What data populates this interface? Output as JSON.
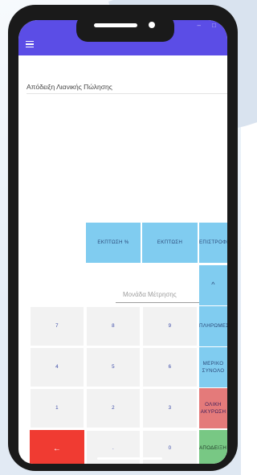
{
  "screen": {
    "title": "Απόδειξη Λιανικής Πώλησης"
  },
  "window_controls": "– □",
  "actions": {
    "discount_percent": "ΕΚΠΤΩΣΗ %",
    "discount": "ΕΚΠΤΩΣΗ",
    "refund": "ΕΠΙΣΤΡΟΦΗ",
    "up_arrow": "^",
    "payments": "ΠΛΗΡΩΜΕΣ",
    "subtotal": "ΜΕΡΙΚΟ ΣΥΝΟΛΟ",
    "total_cancel": "ΟΛΙΚΗ ΑΚΥΡΩΣΗ",
    "receipt": "ΑΠΟΔΕΙΞΗ",
    "backspace": "←"
  },
  "unit_select": {
    "placeholder": "Μονάδα Μέτρησης"
  },
  "keypad": {
    "k7": "7",
    "k8": "8",
    "k9": "9",
    "k4": "4",
    "k5": "5",
    "k6": "6",
    "k1": "1",
    "k2": "2",
    "k3": "3",
    "dot": ".",
    "k0": "0"
  },
  "colors": {
    "topbar": "#5b4de6",
    "action_blue": "#80ccf0",
    "backspace_red": "#f03b32",
    "cancel_salmon": "#e47a7a",
    "receipt_green": "#78c884",
    "key_grey": "#f2f2f2"
  },
  "icons": [
    "menu-icon",
    "chevron-up-icon",
    "dropdown-arrow-icon",
    "backspace-arrow-icon"
  ]
}
